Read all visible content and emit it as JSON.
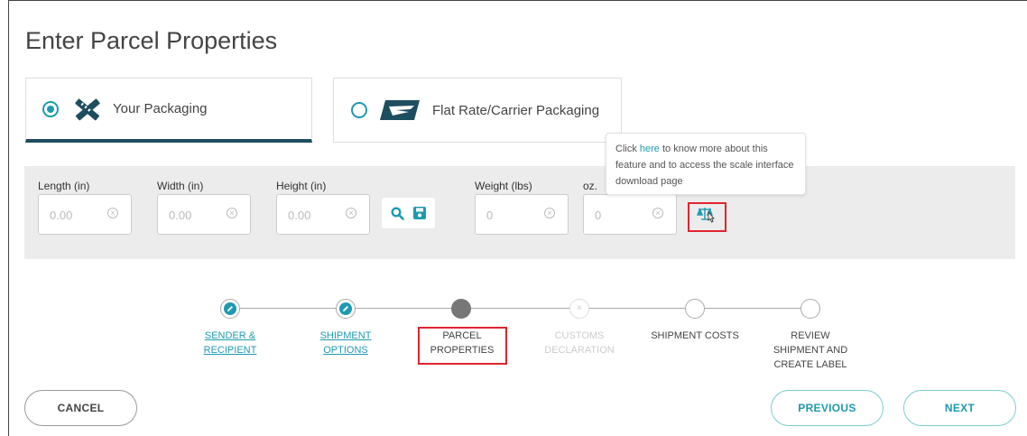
{
  "page": {
    "title": "Enter Parcel Properties"
  },
  "packaging": {
    "your_label": "Your Packaging",
    "flat_label": "Flat Rate/Carrier Packaging",
    "selected": "your"
  },
  "fields": {
    "length": {
      "label": "Length (in)",
      "placeholder": "0.00"
    },
    "width": {
      "label": "Width (in)",
      "placeholder": "0.00"
    },
    "height": {
      "label": "Height (in)",
      "placeholder": "0.00"
    },
    "weight": {
      "label": "Weight (lbs)",
      "placeholder": "0"
    },
    "oz": {
      "label": "oz.",
      "placeholder": "0"
    }
  },
  "tooltip": {
    "prefix": "Click ",
    "link": "here",
    "suffix": " to know more about this feature and to access the scale interface download page"
  },
  "steps": [
    {
      "label": "SENDER &\nRECIPIENT",
      "state": "done"
    },
    {
      "label": "SHIPMENT\nOPTIONS",
      "state": "done"
    },
    {
      "label": "PARCEL\nPROPERTIES",
      "state": "current"
    },
    {
      "label": "CUSTOMS\nDECLARATION",
      "state": "disabled"
    },
    {
      "label": "SHIPMENT COSTS",
      "state": "pending"
    },
    {
      "label": "REVIEW\nSHIPMENT AND\nCREATE LABEL",
      "state": "pending"
    }
  ],
  "buttons": {
    "cancel": "CANCEL",
    "previous": "PREVIOUS",
    "next": "NEXT"
  },
  "colors": {
    "accent": "#1d9ab0",
    "dark": "#1d4e5f",
    "highlight": "#e0242f",
    "band": "#ececec"
  }
}
